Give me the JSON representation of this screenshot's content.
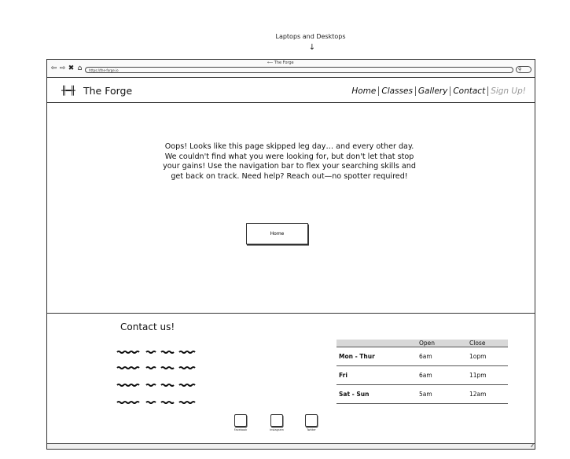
{
  "device_label": "Laptops and Desktops",
  "browser": {
    "tab_title": "The Forge",
    "url": "https://the-forge.io",
    "nav_icons": [
      "back-icon",
      "forward-icon",
      "close-icon",
      "home-icon"
    ]
  },
  "header": {
    "logo_text": "The Forge",
    "nav": {
      "home": "Home",
      "classes": "Classes",
      "gallery": "Gallery",
      "contact": "Contact",
      "signup": "Sign Up!"
    }
  },
  "main": {
    "message": "Oops! Looks like this page skipped leg day… and every other day. We couldn't find what you were looking for, but don't let that stop your gains! Use the navigation bar to flex your searching skills and get back on track. Need help? Reach out—no spotter required!",
    "home_button": "Home"
  },
  "footer": {
    "contact_title": "Contact us!",
    "hours": {
      "headers": [
        "",
        "Open",
        "Close"
      ],
      "rows": [
        {
          "day": "Mon - Thur",
          "open": "6am",
          "close": "1opm"
        },
        {
          "day": "Fri",
          "open": "6am",
          "close": "11pm"
        },
        {
          "day": "Sat - Sun",
          "open": "5am",
          "close": "12am"
        }
      ]
    },
    "social": {
      "facebook": "Facebook",
      "instagram": "Instagram",
      "twitter": "Twitter"
    }
  },
  "colors": {
    "sign_up": "#999999",
    "table_header": "#d8d8d8"
  }
}
